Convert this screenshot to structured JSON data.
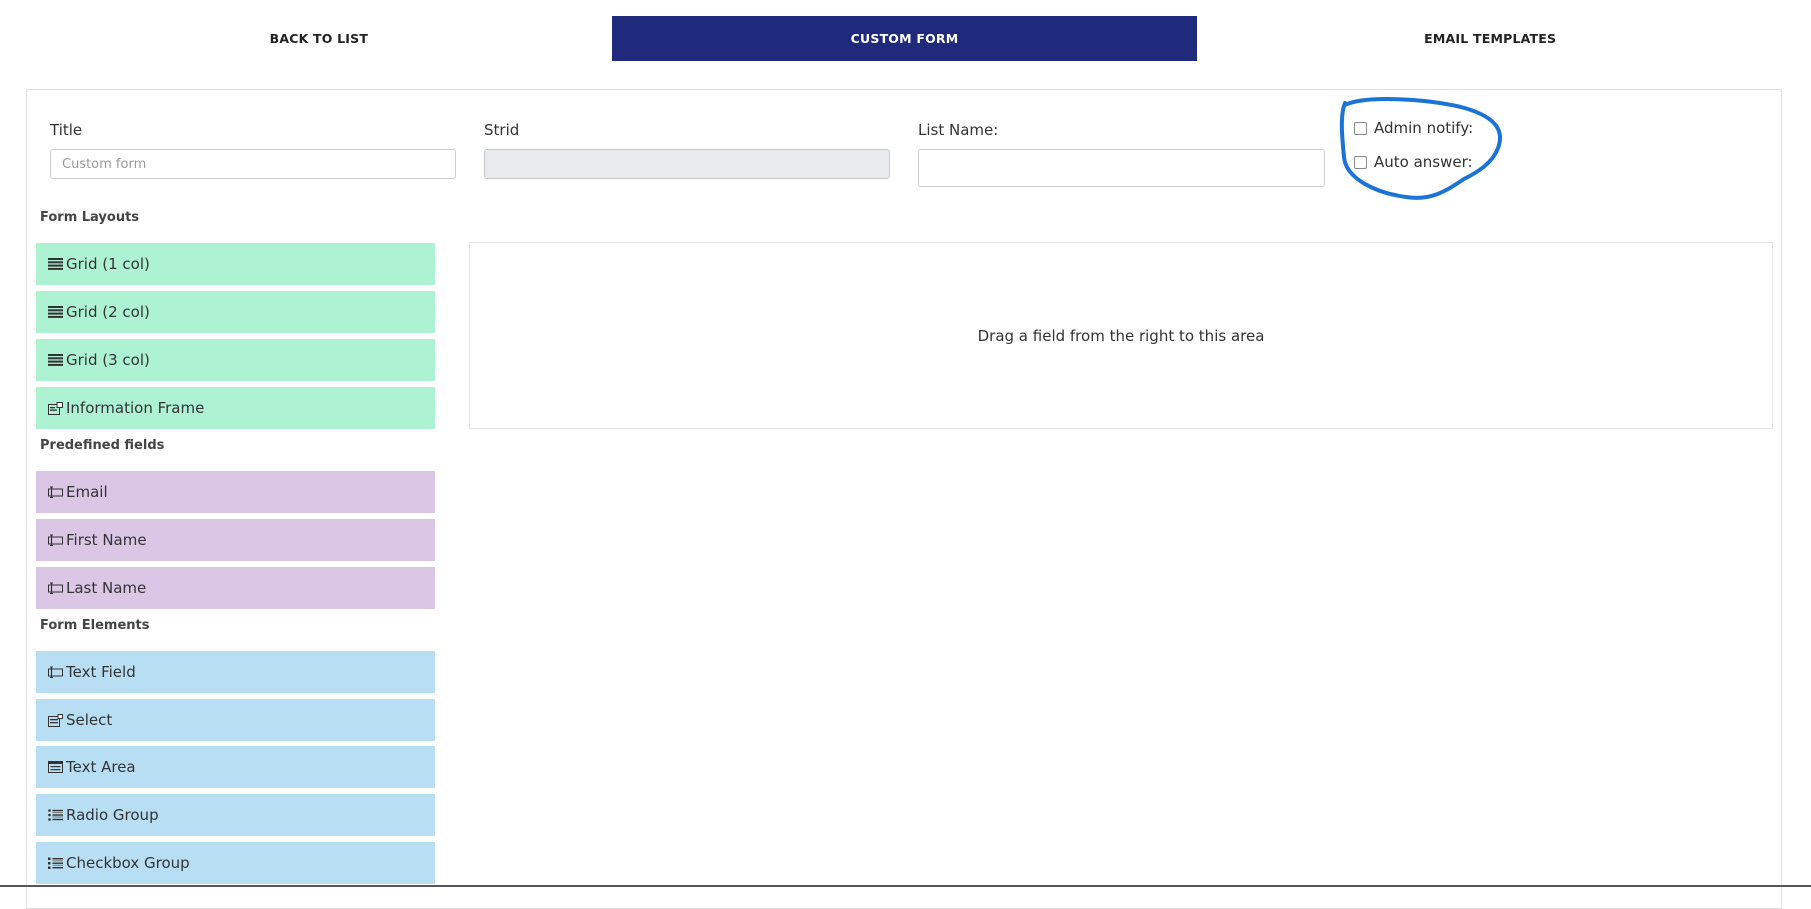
{
  "nav": {
    "tabs": [
      {
        "label": "BACK TO LIST",
        "active": false
      },
      {
        "label": "CUSTOM FORM",
        "active": true
      },
      {
        "label": "EMAIL TEMPLATES",
        "active": false
      }
    ],
    "active_color": "#1f2a7c"
  },
  "form": {
    "title": {
      "label": "Title",
      "value": "",
      "placeholder": "Custom form"
    },
    "strid": {
      "label": "Strid",
      "value": "",
      "disabled": true
    },
    "list_name": {
      "label": "List Name:",
      "value": ""
    },
    "admin_notify": {
      "label": "Admin notify:",
      "checked": false
    },
    "auto_answer": {
      "label": "Auto answer:",
      "checked": false
    }
  },
  "annotation_color": "#1a73d6",
  "palette": {
    "layouts": {
      "heading": "Form Layouts",
      "color": "#aef2d4",
      "items": [
        {
          "label": "Grid (1 col)",
          "icon": "grid-icon"
        },
        {
          "label": "Grid (2 col)",
          "icon": "grid-icon"
        },
        {
          "label": "Grid (3 col)",
          "icon": "grid-icon"
        },
        {
          "label": "Information Frame",
          "icon": "info-frame-icon"
        }
      ]
    },
    "predefined": {
      "heading": "Predefined fields",
      "color": "#dbc6e6",
      "items": [
        {
          "label": "Email",
          "icon": "text-field-icon"
        },
        {
          "label": "First Name",
          "icon": "text-field-icon"
        },
        {
          "label": "Last Name",
          "icon": "text-field-icon"
        }
      ]
    },
    "elements": {
      "heading": "Form Elements",
      "color": "#b8def4",
      "items": [
        {
          "label": "Text Field",
          "icon": "text-field-icon"
        },
        {
          "label": "Select",
          "icon": "select-icon"
        },
        {
          "label": "Text Area",
          "icon": "textarea-icon"
        },
        {
          "label": "Radio Group",
          "icon": "radio-list-icon"
        },
        {
          "label": "Checkbox Group",
          "icon": "checkbox-list-icon"
        }
      ]
    }
  },
  "dropzone": {
    "text": "Drag a field from the right to this area"
  }
}
